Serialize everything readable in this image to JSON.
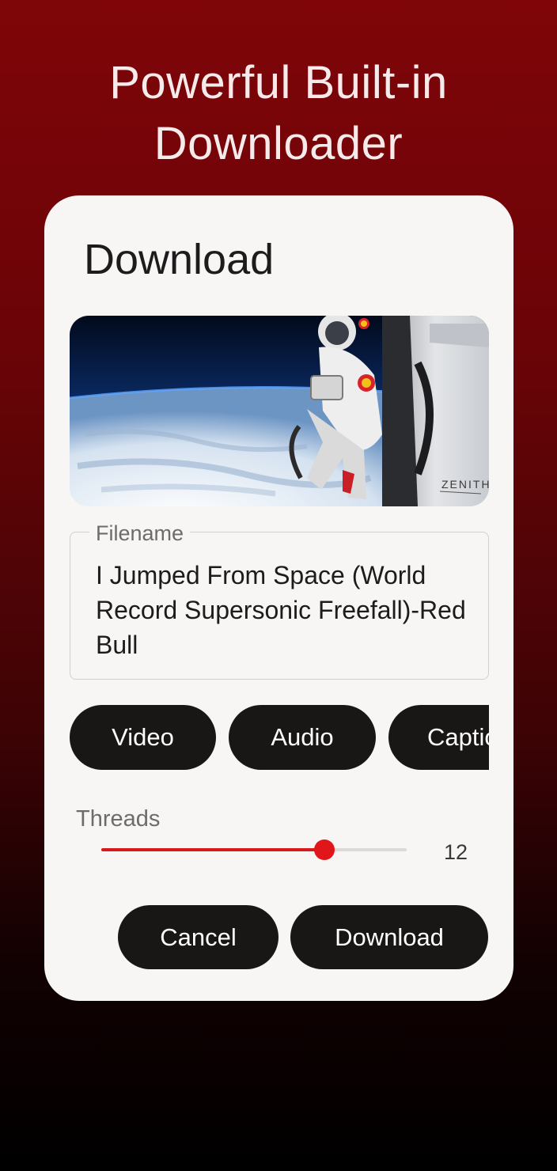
{
  "promo": {
    "headline_line1": "Powerful Built-in",
    "headline_line2": "Downloader"
  },
  "dialog": {
    "title": "Download",
    "thumbnail": {
      "watermark": "ZENITH"
    },
    "filename": {
      "label": "Filename",
      "value": "I Jumped From Space (World Record Supersonic Freefall)-Red Bull"
    },
    "format_options": [
      "Video",
      "Audio",
      "Captions"
    ],
    "threads": {
      "label": "Threads",
      "value": "12",
      "fill_fraction": 0.73
    },
    "buttons": {
      "cancel": "Cancel",
      "download": "Download"
    }
  },
  "colors": {
    "background_top": "#7f0508",
    "background_bottom": "#000000",
    "dialog_bg": "#f7f6f4",
    "button_bg": "#181716",
    "accent": "#d7191c"
  }
}
